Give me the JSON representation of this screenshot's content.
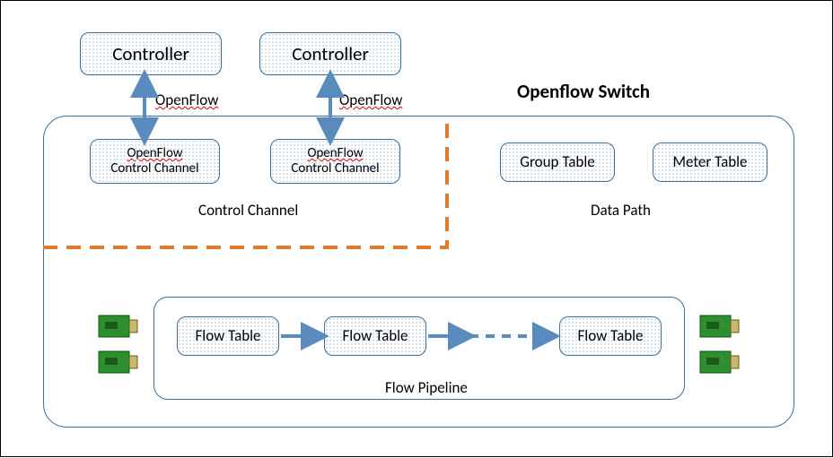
{
  "title": "Openflow Switch",
  "controller1": "Controller",
  "controller2": "Controller",
  "protocol1": "OpenFlow",
  "protocol2": "OpenFlow",
  "cc1_line1": "OpenFlow",
  "cc1_line2": "Control Channel",
  "cc2_line1": "OpenFlow",
  "cc2_line2": "Control Channel",
  "section_control": "Control Channel",
  "section_data": "Data Path",
  "group_table": "Group Table",
  "meter_table": "Meter Table",
  "flow_table1": "Flow Table",
  "flow_table2": "Flow Table",
  "flow_table3": "Flow Table",
  "flow_pipeline": "Flow Pipeline",
  "colors": {
    "box_border": "#3b6fa0",
    "arrow": "#5a8bbf",
    "dashed": "#e07b2e"
  }
}
